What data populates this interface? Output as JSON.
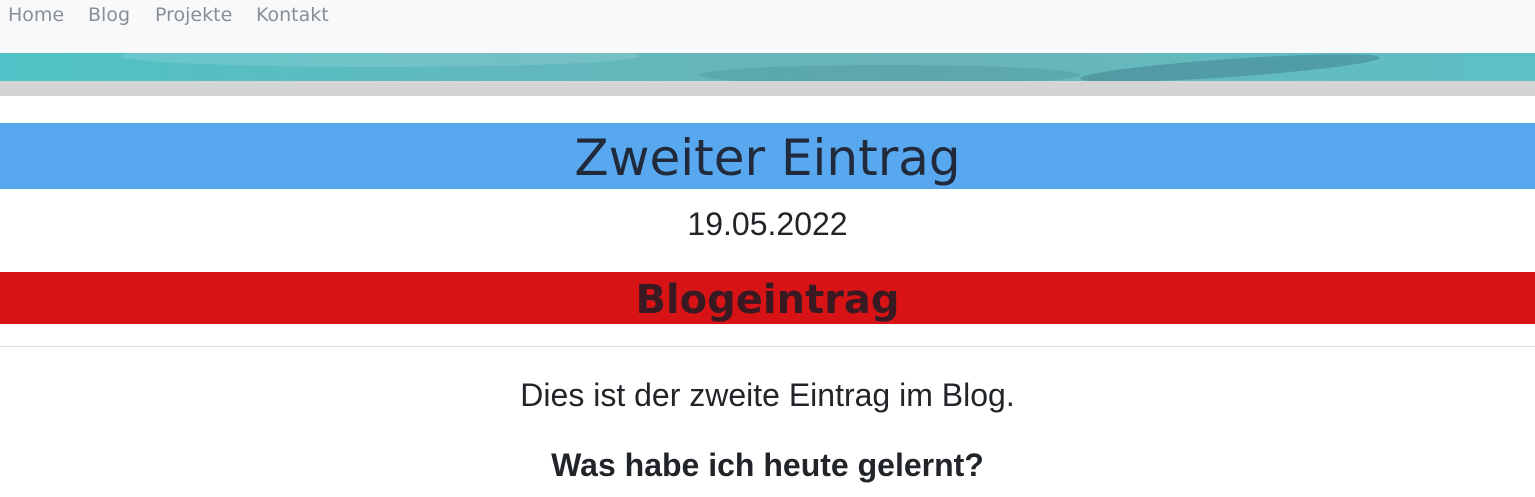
{
  "nav": {
    "items": [
      {
        "label": "Home"
      },
      {
        "label": "Blog"
      },
      {
        "label": "Projekte"
      },
      {
        "label": "Kontakt"
      }
    ]
  },
  "post": {
    "title": "Zweiter Eintrag",
    "date": "19.05.2022",
    "section_heading": "Blogeintrag",
    "intro": "Dies ist der zweite Eintrag im Blog.",
    "subheading": "Was habe ich heute gelernt?"
  },
  "colors": {
    "navbar_bg": "#f8f9fa",
    "title_band": "#58a8f0",
    "section_band": "#d71315",
    "grey_bar": "#d4d4d6",
    "hero_teal": "#5fb9bd"
  }
}
